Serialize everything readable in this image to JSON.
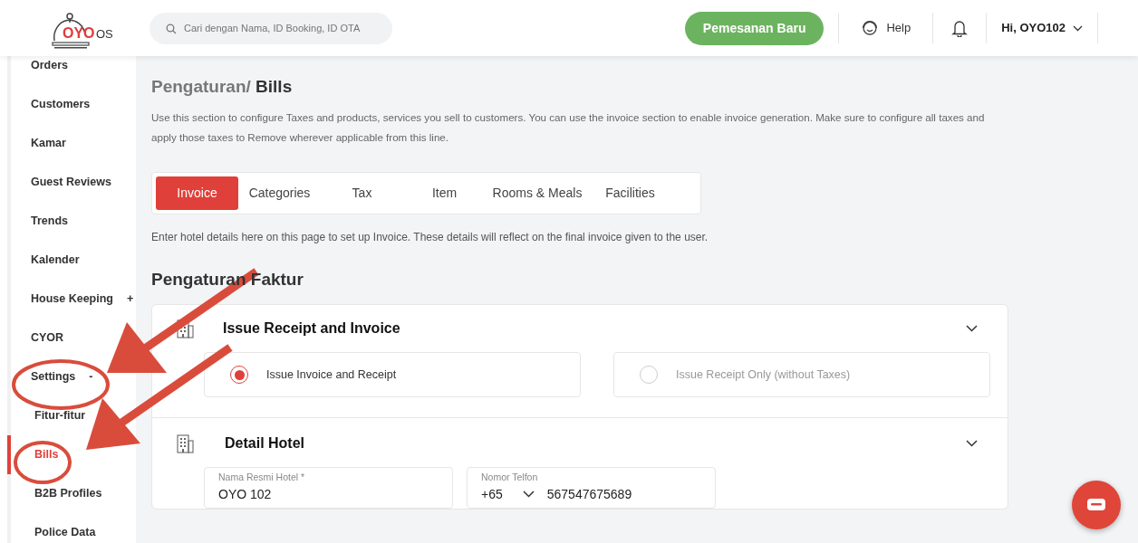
{
  "header": {
    "logo": {
      "brand": "OYO",
      "suffix": "OS"
    },
    "search": {
      "placeholder": "Cari dengan Nama, ID Booking, ID OTA"
    },
    "new_booking_button": "Pemesanan Baru",
    "help": "Help",
    "user_menu": "Hi, OYO102"
  },
  "sidebar": {
    "items": [
      {
        "label": "Orders",
        "selected": false
      },
      {
        "label": "Customers",
        "selected": false
      },
      {
        "label": "Kamar",
        "selected": false
      },
      {
        "label": "Guest Reviews",
        "selected": false
      },
      {
        "label": "Trends",
        "selected": false
      },
      {
        "label": "Kalender",
        "selected": false
      },
      {
        "label": "House Keeping",
        "selected": false,
        "expander": "+"
      },
      {
        "label": "CYOR",
        "selected": false
      },
      {
        "label": "Settings",
        "selected": false,
        "expander": "-",
        "children": [
          {
            "label": "Fitur-fitur",
            "selected": false
          },
          {
            "label": "Bills",
            "selected": true
          },
          {
            "label": "B2B Profiles",
            "selected": false
          },
          {
            "label": "Police Data",
            "selected": false
          }
        ]
      }
    ]
  },
  "breadcrumb": {
    "parent": "Pengaturan/",
    "current": "Bills"
  },
  "description": "Use this section to configure Taxes and products, services you sell to customers. You can use the invoice section to enable invoice generation. Make sure to configure all taxes and apply those taxes to Remove wherever applicable from this line.",
  "tabs": [
    {
      "label": "Invoice",
      "selected": true
    },
    {
      "label": "Categories",
      "selected": false
    },
    {
      "label": "Tax",
      "selected": false
    },
    {
      "label": "Item",
      "selected": false
    },
    {
      "label": "Rooms & Meals",
      "selected": false
    },
    {
      "label": "Facilities",
      "selected": false
    }
  ],
  "tab_hint": "Enter hotel details here on this page to set up Invoice. These details will reflect on the final invoice given to the user.",
  "section_title": "Pengaturan Faktur",
  "panels": [
    {
      "kind": "options",
      "title": "Issue Receipt and Invoice",
      "options": [
        {
          "label": "Issue Invoice and Receipt",
          "selected": true
        },
        {
          "label": "Issue Receipt Only (without Taxes)",
          "selected": false
        }
      ]
    },
    {
      "kind": "fields",
      "title": "Detail Hotel",
      "fields": [
        {
          "kind": "text",
          "label": "Nama Resmi Hotel *",
          "value": "OYO 102"
        },
        {
          "kind": "phone",
          "label": "Nomor Telfon",
          "code": "+65",
          "value": "567547675689"
        }
      ]
    }
  ]
}
